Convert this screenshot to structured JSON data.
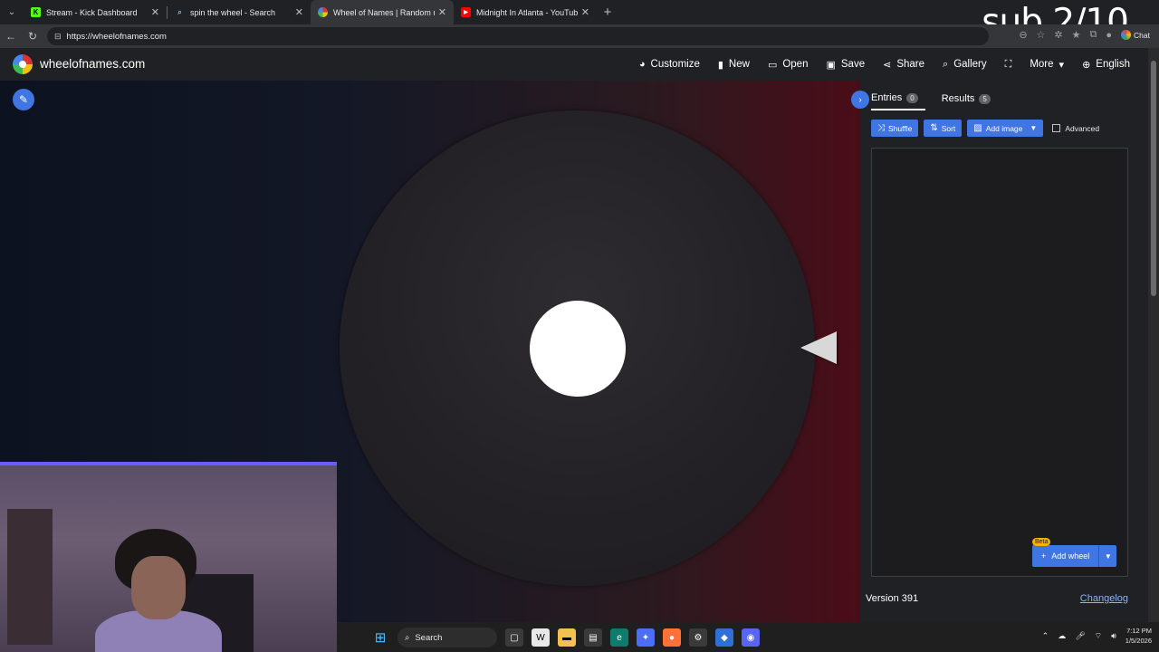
{
  "browser": {
    "tabs": [
      {
        "title": "Stream - Kick Dashboard",
        "favicon": "kick-icon",
        "color": "#53fc18",
        "active": false
      },
      {
        "title": "spin the wheel - Search",
        "favicon": "search-icon",
        "color": "#3f76e4",
        "active": false
      },
      {
        "title": "Wheel of Names | Random name p",
        "favicon": "wheel-icon",
        "color": "#db3236",
        "active": true
      },
      {
        "title": "Midnight In Atlanta - YouTube",
        "favicon": "youtube-icon",
        "color": "#ff0000",
        "active": false
      }
    ],
    "url": "https://wheelofnames.com",
    "chat_label": "Chat"
  },
  "overlay": {
    "sub_counter": "sub 2/10"
  },
  "site": {
    "name": "wheelofnames.com",
    "menu": [
      {
        "label": "Customize",
        "icon": "palette-icon"
      },
      {
        "label": "New",
        "icon": "file-icon"
      },
      {
        "label": "Open",
        "icon": "folder-icon"
      },
      {
        "label": "Save",
        "icon": "save-icon"
      },
      {
        "label": "Share",
        "icon": "share-icon"
      },
      {
        "label": "Gallery",
        "icon": "search-icon"
      },
      {
        "label": "",
        "icon": "fullscreen-icon"
      },
      {
        "label": "More",
        "icon": "chevron-down-icon"
      },
      {
        "label": "English",
        "icon": "globe-icon"
      }
    ]
  },
  "panel": {
    "tabs": [
      {
        "label": "Entries",
        "count": "0",
        "active": true
      },
      {
        "label": "Results",
        "count": "5",
        "active": false
      }
    ],
    "toolbar": {
      "shuffle": "Shuffle",
      "sort": "Sort",
      "add_image": "Add image",
      "advanced": "Advanced"
    },
    "entries_text": "",
    "add_wheel": "Add wheel",
    "beta_badge": "Beta",
    "version": "Version 391",
    "changelog": "Changelog"
  },
  "taskbar": {
    "search_label": "Search",
    "time": "7:12 PM",
    "date": "1/5/2026"
  },
  "colors": {
    "accent": "#3f76e4",
    "page_bg": "#202124"
  }
}
